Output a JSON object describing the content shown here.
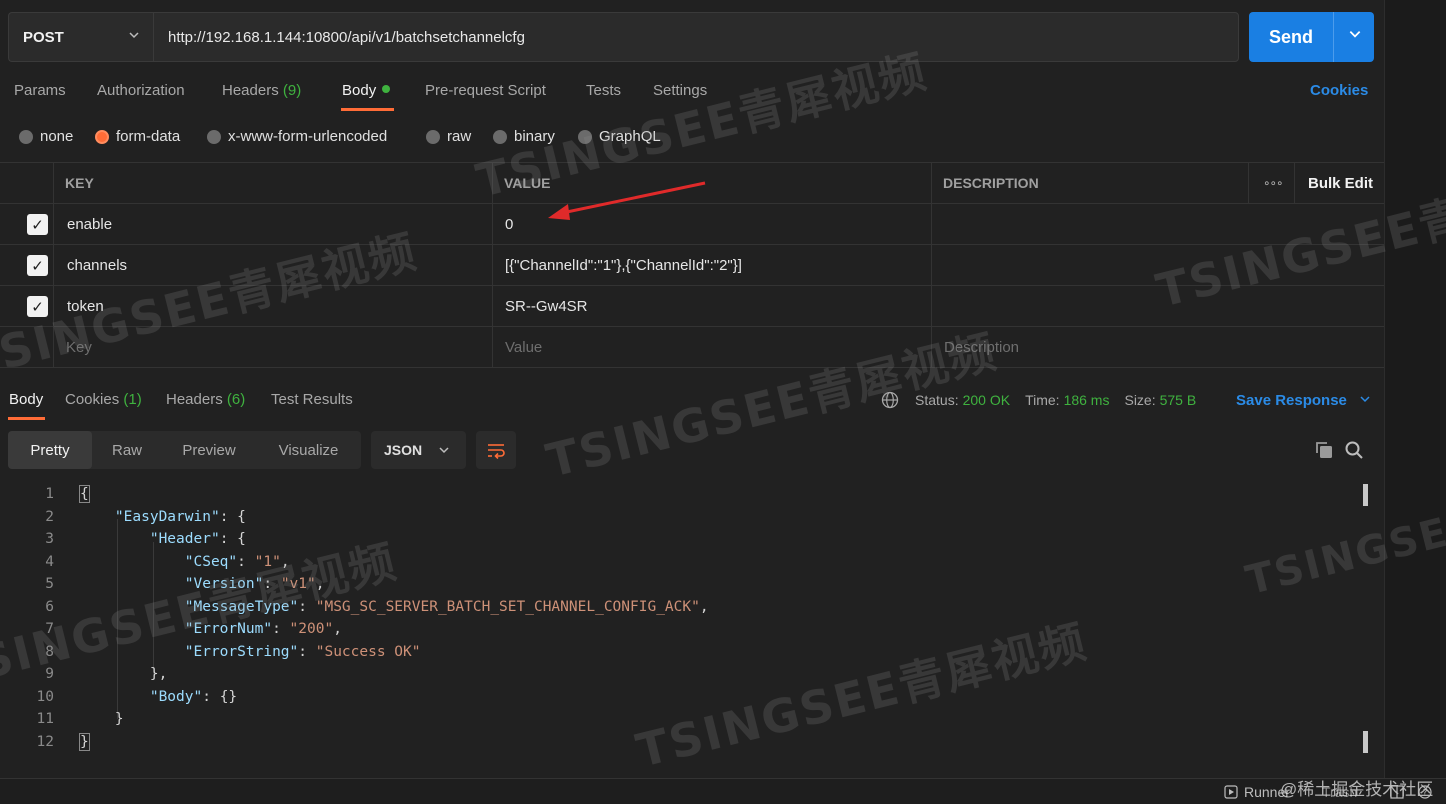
{
  "request": {
    "method": "POST",
    "url": "http://192.168.1.144:10800/api/v1/batchsetchannelcfg",
    "send_label": "Send"
  },
  "request_tabs": {
    "params": "Params",
    "authorization": "Authorization",
    "headers": "Headers",
    "headers_count": "(9)",
    "body": "Body",
    "prerequest": "Pre-request Script",
    "tests": "Tests",
    "settings": "Settings",
    "cookies": "Cookies"
  },
  "body_types": {
    "none": "none",
    "form_data": "form-data",
    "urlencoded": "x-www-form-urlencoded",
    "raw": "raw",
    "binary": "binary",
    "graphql": "GraphQL",
    "selected": "form-data"
  },
  "params_table": {
    "headers": {
      "key": "KEY",
      "value": "VALUE",
      "description": "DESCRIPTION",
      "more": "∘∘∘",
      "bulk_edit": "Bulk Edit"
    },
    "rows": [
      {
        "key": "enable",
        "value": "0",
        "checked": true
      },
      {
        "key": "channels",
        "value": "[{\"ChannelId\":\"1\"},{\"ChannelId\":\"2\"}]",
        "checked": true
      },
      {
        "key": "token",
        "value": "SR--Gw4SR",
        "checked": true
      }
    ],
    "placeholders": {
      "key": "Key",
      "value": "Value",
      "description": "Description"
    }
  },
  "response_tabs": {
    "body": "Body",
    "cookies": "Cookies",
    "cookies_count": "(1)",
    "headers": "Headers",
    "headers_count": "(6)",
    "test_results": "Test Results"
  },
  "response_status": {
    "status_label": "Status:",
    "status_value": "200 OK",
    "time_label": "Time:",
    "time_value": "186 ms",
    "size_label": "Size:",
    "size_value": "575 B",
    "save_response": "Save Response"
  },
  "response_view": {
    "pretty": "Pretty",
    "raw": "Raw",
    "preview": "Preview",
    "visualize": "Visualize",
    "format": "JSON"
  },
  "response_body": {
    "line_numbers": [
      "1",
      "2",
      "3",
      "4",
      "5",
      "6",
      "7",
      "8",
      "9",
      "10",
      "11",
      "12"
    ],
    "root_key": "\"EasyDarwin\"",
    "header_key": "\"Header\"",
    "fields": [
      {
        "key": "\"CSeq\"",
        "value": "\"1\""
      },
      {
        "key": "\"Version\"",
        "value": "\"v1\""
      },
      {
        "key": "\"MessageType\"",
        "value": "\"MSG_SC_SERVER_BATCH_SET_CHANNEL_CONFIG_ACK\""
      },
      {
        "key": "\"ErrorNum\"",
        "value": "\"200\""
      },
      {
        "key": "\"ErrorString\"",
        "value": "\"Success OK\""
      }
    ],
    "body_key": "\"Body\"",
    "body_value": "{}"
  },
  "footer": {
    "runner": "Runner",
    "trash": "Trash",
    "site_watermark": "@稀土掘金技术社区"
  },
  "watermark_text": "TSINGSEE青犀视频",
  "colors": {
    "accent": "#ff6c37",
    "link": "#2b8be6",
    "send": "#1a7fe3",
    "success": "#3fb23f"
  }
}
